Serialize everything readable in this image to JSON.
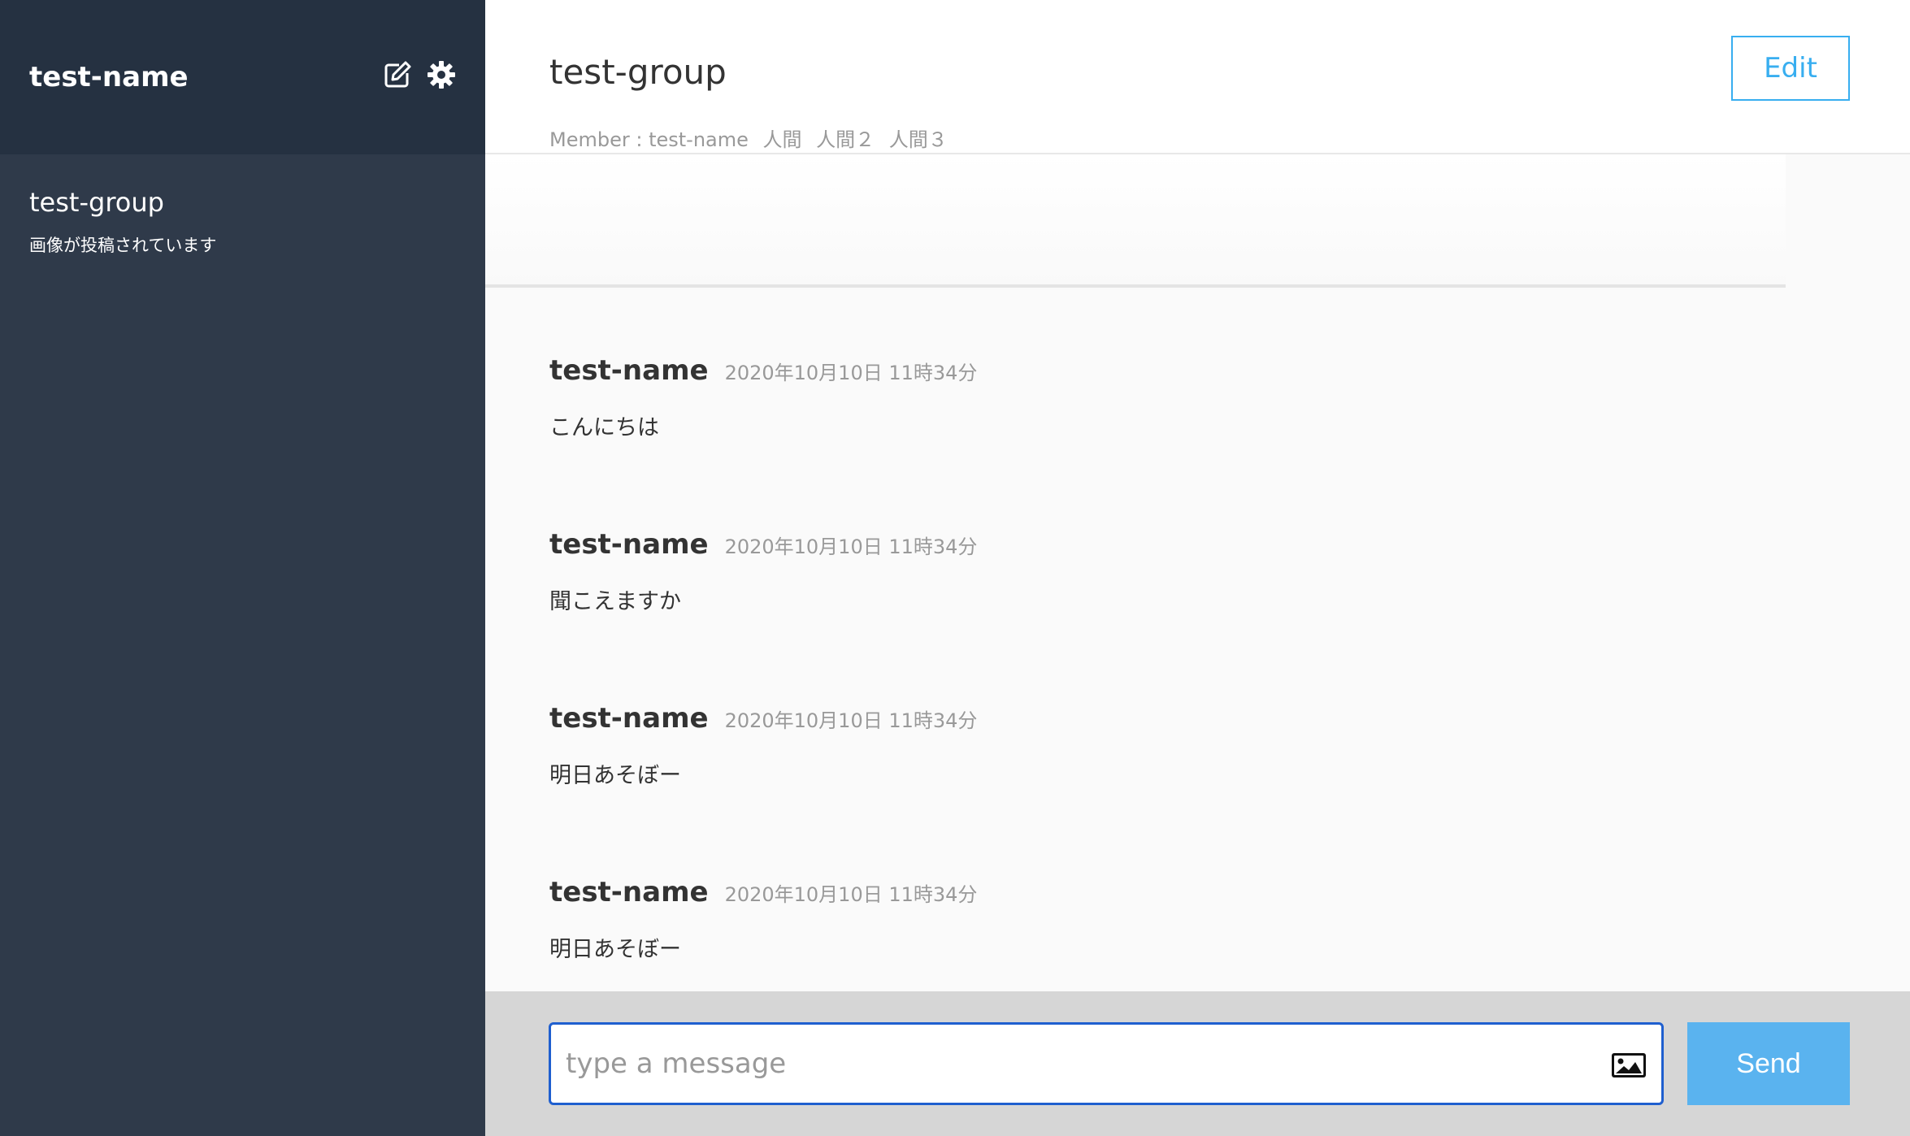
{
  "sidebar": {
    "user_name": "test-name",
    "icons": [
      "edit-icon",
      "gear-icon"
    ],
    "groups": [
      {
        "name": "test-group",
        "last_message": "画像が投稿されています"
      }
    ]
  },
  "header": {
    "group_name": "test-group",
    "member_label": "Member : test-name",
    "members": [
      "人間",
      "人間２",
      "人間３"
    ],
    "edit_label": "Edit"
  },
  "messages": [
    {
      "user": "test-name",
      "date": "2020年10月10日 11時34分",
      "text": "こんにちは"
    },
    {
      "user": "test-name",
      "date": "2020年10月10日 11時34分",
      "text": "聞こえますか"
    },
    {
      "user": "test-name",
      "date": "2020年10月10日 11時34分",
      "text": "明日あそぼー"
    },
    {
      "user": "test-name",
      "date": "2020年10月10日 11時34分",
      "text": "明日あそぼー"
    }
  ],
  "form": {
    "placeholder": "type a message",
    "image_icon": "image-icon",
    "send_label": "Send"
  },
  "colors": {
    "sidebar_bg": "#2f3a4a",
    "sidebar_header_bg": "#253141",
    "accent": "#38aef0",
    "send_bg": "#5ab3ef",
    "input_border": "#1f5fcf"
  }
}
